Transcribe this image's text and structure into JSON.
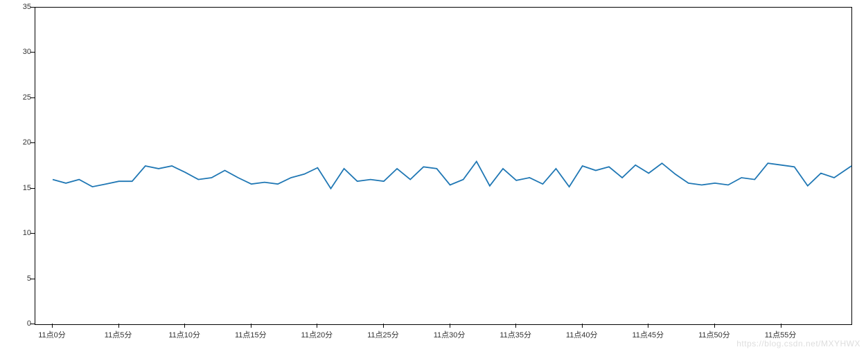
{
  "chart_data": {
    "type": "line",
    "title": "",
    "xlabel": "",
    "ylabel": "",
    "ylim": [
      0,
      35
    ],
    "yticks": [
      0,
      5,
      10,
      15,
      20,
      25,
      30,
      35
    ],
    "xtick_labels": [
      "11点0分",
      "11点5分",
      "11点10分",
      "11点15分",
      "11点20分",
      "11点25分",
      "11点30分",
      "11点35分",
      "11点40分",
      "11点45分",
      "11点50分",
      "11点55分"
    ],
    "xtick_every": 5,
    "categories": [
      "11点0分",
      "11点1分",
      "11点2分",
      "11点3分",
      "11点4分",
      "11点5分",
      "11点6分",
      "11点7分",
      "11点8分",
      "11点9分",
      "11点10分",
      "11点11分",
      "11点12分",
      "11点13分",
      "11点14分",
      "11点15分",
      "11点16分",
      "11点17分",
      "11点18分",
      "11点19分",
      "11点20分",
      "11点21分",
      "11点22分",
      "11点23分",
      "11点24分",
      "11点25分",
      "11点26分",
      "11点27分",
      "11点28分",
      "11点29分",
      "11点30分",
      "11点31分",
      "11点32分",
      "11点33分",
      "11点34分",
      "11点35分",
      "11点36分",
      "11点37分",
      "11点38分",
      "11点39分",
      "11点40分",
      "11点41分",
      "11点42分",
      "11点43分",
      "11点44分",
      "11点45分",
      "11点46分",
      "11点47分",
      "11点48分",
      "11点49分",
      "11点50分",
      "11点51分",
      "11点52分",
      "11点53分",
      "11点54分",
      "11点55分",
      "11点56分",
      "11点57分",
      "11点58分",
      "11点59分"
    ],
    "values": [
      16.0,
      15.6,
      16.0,
      15.2,
      15.5,
      15.8,
      15.8,
      17.5,
      17.2,
      17.5,
      16.8,
      16.0,
      16.2,
      17.0,
      16.2,
      15.5,
      15.7,
      15.5,
      16.2,
      16.6,
      17.3,
      15.0,
      17.2,
      15.8,
      16.0,
      15.8,
      17.2,
      16.0,
      17.4,
      17.2,
      15.4,
      16.0,
      18.0,
      15.3,
      17.2,
      15.9,
      16.2,
      15.5,
      17.2,
      15.2,
      17.5,
      17.0,
      17.4,
      16.2,
      17.6,
      16.7,
      17.8,
      16.6,
      15.6,
      15.4,
      15.6,
      15.4,
      16.2,
      16.0,
      17.8,
      17.6,
      17.4,
      15.3,
      16.7,
      16.2
    ],
    "line_color": "#1f77b4"
  },
  "watermark": "https://blog.csdn.net/MXYHWX"
}
